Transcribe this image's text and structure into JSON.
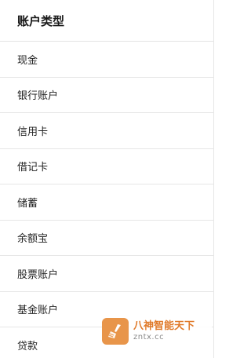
{
  "header": {
    "title": "账户类型"
  },
  "account_types": [
    {
      "label": "现金"
    },
    {
      "label": "银行账户"
    },
    {
      "label": "信用卡"
    },
    {
      "label": "借记卡"
    },
    {
      "label": "储蓄"
    },
    {
      "label": "余额宝"
    },
    {
      "label": "股票账户"
    },
    {
      "label": "基金账户"
    },
    {
      "label": "贷款"
    }
  ],
  "watermark": {
    "line1": "八神智能天下",
    "line2": "zntx.cc",
    "logo_icon": "broom-logo-icon",
    "accent_color": "#e8954a"
  }
}
